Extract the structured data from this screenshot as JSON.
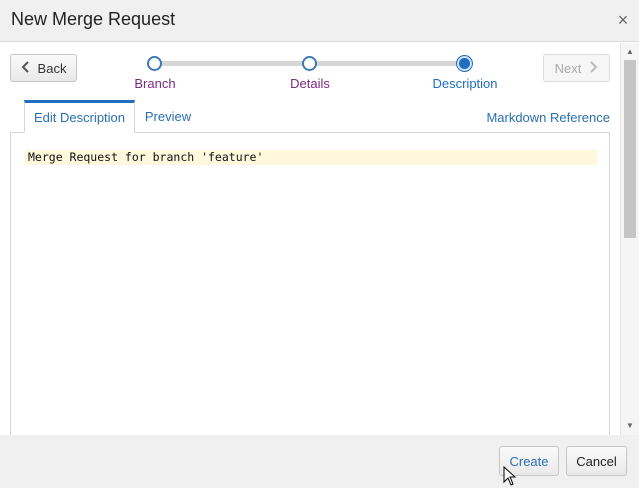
{
  "dialog": {
    "title": "New Merge Request",
    "close_symbol": "×"
  },
  "nav": {
    "back_label": "Back",
    "next_label": "Next"
  },
  "steps": [
    {
      "label": "Branch",
      "state": "completed"
    },
    {
      "label": "Details",
      "state": "completed"
    },
    {
      "label": "Description",
      "state": "current"
    }
  ],
  "tabs": {
    "edit_label": "Edit Description",
    "preview_label": "Preview",
    "markdown_reference": "Markdown Reference"
  },
  "editor": {
    "text": "Merge Request for branch 'feature'"
  },
  "footer": {
    "create_label": "Create",
    "cancel_label": "Cancel"
  },
  "colors": {
    "accent": "#1f6fc1",
    "visited": "#7a2a82",
    "link": "#2a6fb3",
    "highlight": "#fff8dc"
  }
}
